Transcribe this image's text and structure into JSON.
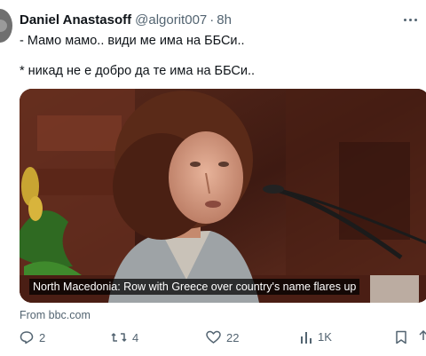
{
  "tweet": {
    "author_name": "Daniel Anastasoff",
    "handle": "@algorit007",
    "separator": "·",
    "time": "8h",
    "text_line1": "- Мамо мамо.. види ме има на ББСи..",
    "text_line2": "* никад не е добро да те има на ББСи.."
  },
  "card": {
    "caption": "North Macedonia: Row with Greece over country's name flares up",
    "source": "From bbc.com"
  },
  "actions": {
    "replies": "2",
    "reposts": "4",
    "likes": "22",
    "views": "1K"
  },
  "icons": {
    "more": "more-horizontal-icon",
    "reply": "reply-icon",
    "repost": "repost-icon",
    "like": "heart-icon",
    "views": "views-chart-icon",
    "bookmark": "bookmark-icon"
  },
  "colors": {
    "text": "#0f1419",
    "secondary": "#536471"
  }
}
